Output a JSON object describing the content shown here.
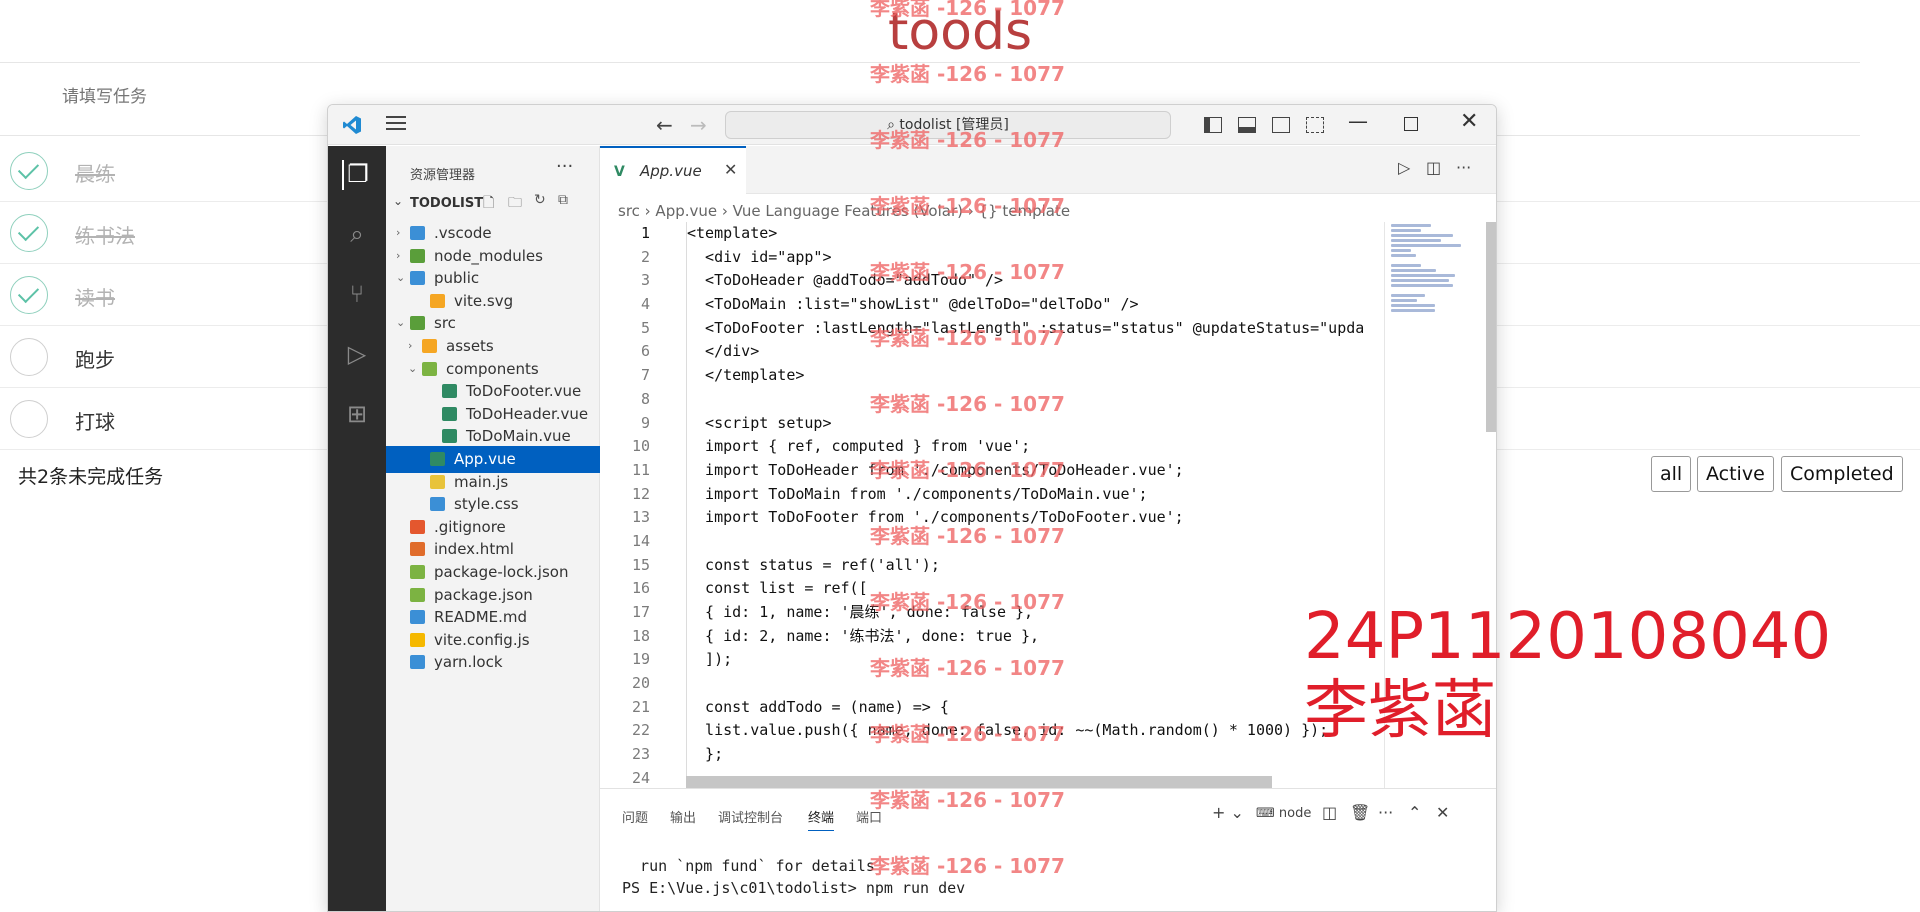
{
  "todo_app": {
    "title": "toods",
    "input_placeholder": "请填写任务",
    "items": [
      {
        "text": "晨练",
        "done": true
      },
      {
        "text": "练书法",
        "done": true
      },
      {
        "text": "读书",
        "done": true
      },
      {
        "text": "跑步",
        "done": false
      },
      {
        "text": "打球",
        "done": false
      }
    ],
    "footer_count": "共2条未完成任务",
    "filters": {
      "all": "all",
      "active": "Active",
      "completed": "Completed"
    }
  },
  "vscode": {
    "title": "todolist [管理员]",
    "sidebar_title": "资源管理器",
    "root_folder": "TODOLIST",
    "tree": [
      {
        "name": ".vscode",
        "chev": "›"
      },
      {
        "name": "node_modules",
        "chev": "›"
      },
      {
        "name": "public",
        "chev": "⌄"
      },
      {
        "name": "vite.svg",
        "chev": ""
      },
      {
        "name": "src",
        "chev": "⌄"
      },
      {
        "name": "assets",
        "chev": "›"
      },
      {
        "name": "components",
        "chev": "⌄"
      },
      {
        "name": "ToDoFooter.vue",
        "chev": ""
      },
      {
        "name": "ToDoHeader.vue",
        "chev": ""
      },
      {
        "name": "ToDoMain.vue",
        "chev": ""
      },
      {
        "name": "App.vue",
        "chev": ""
      },
      {
        "name": "main.js",
        "chev": ""
      },
      {
        "name": "style.css",
        "chev": ""
      },
      {
        "name": ".gitignore",
        "chev": ""
      },
      {
        "name": "index.html",
        "chev": ""
      },
      {
        "name": "package-lock.json",
        "chev": ""
      },
      {
        "name": "package.json",
        "chev": ""
      },
      {
        "name": "README.md",
        "chev": ""
      },
      {
        "name": "vite.config.js",
        "chev": ""
      },
      {
        "name": "yarn.lock",
        "chev": ""
      }
    ],
    "tab": "App.vue",
    "breadcrumb": "src  ›  App.vue  ›  Vue Language Features (Volar)  ›  {} template",
    "line_numbers": [
      "1",
      "2",
      "3",
      "4",
      "5",
      "6",
      "7",
      "8",
      "9",
      "10",
      "11",
      "12",
      "13",
      "14",
      "15",
      "16",
      "17",
      "18",
      "19",
      "20",
      "21",
      "22",
      "23",
      "24"
    ],
    "code_lines": [
      "<template>",
      "  <div id=\"app\">",
      "  <ToDoHeader @addTodo=\"addTodo\" />",
      "  <ToDoMain :list=\"showList\" @delToDo=\"delToDo\" />",
      "  <ToDoFooter :lastLength=\"lastLength\" :status=\"status\" @updateStatus=\"upda",
      "  </div>",
      "  </template>",
      "",
      "  <script setup>",
      "  import { ref, computed } from 'vue';",
      "  import ToDoHeader from './components/ToDoHeader.vue';",
      "  import ToDoMain from './components/ToDoMain.vue';",
      "  import ToDoFooter from './components/ToDoFooter.vue';",
      "",
      "  const status = ref('all');",
      "  const list = ref([",
      "  { id: 1, name: '晨练', done: false },",
      "  { id: 2, name: '练书法', done: true },",
      "  ]);",
      "",
      "  const addTodo = (name) => {",
      "  list.value.push({ name, done: false, id: ~~(Math.random() * 1000) });",
      "  };",
      ""
    ],
    "panel_tabs": [
      "问题",
      "输出",
      "调试控制台",
      "终端",
      "端口"
    ],
    "terminal_label": "node",
    "terminal_lines": [
      "  run `npm fund` for details",
      "PS E:\\Vue.js\\c01\\todolist> npm run dev"
    ]
  },
  "overlays": {
    "watermark": "李紫菡 -126 - 1077",
    "stamp_id": "24P1120108040",
    "stamp_name": "李紫菡"
  },
  "colors": {
    "accent": "#0060c0",
    "todo_title": "#b83f3f",
    "stamp": "#e01e2a",
    "vue_green": "#2f8a63"
  }
}
